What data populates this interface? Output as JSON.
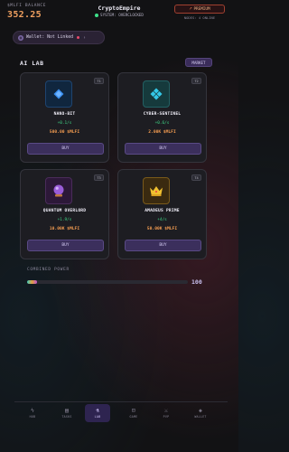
{
  "header": {
    "balance_label": "$MLFI BALANCE",
    "balance_value": "352.25",
    "app_title": "CryptoEmpire",
    "system_status": "SYSTEM: OVERCLOCKED",
    "premium_label": "PREMIUM",
    "server_info": "NODES: 4 ONLINE"
  },
  "wallet": {
    "label": "Wallet: Not Linked"
  },
  "section": {
    "title": "AI LAB",
    "market_label": "MARKET"
  },
  "items": [
    {
      "level": "T1",
      "name": "NANO-BIT",
      "rate": "+0.1/s",
      "cost": "500.00 $MLFI",
      "buy_label": "BUY",
      "icon": "diamond-icon",
      "icon_color": "#3a8ff0"
    },
    {
      "level": "T2",
      "name": "CYBER-SENTINEL",
      "rate": "+0.6/s",
      "cost": "2.00K $MLFI",
      "buy_label": "BUY",
      "icon": "quad-diamond-icon",
      "icon_color": "#34c8e8"
    },
    {
      "level": "T3",
      "name": "QUANTUM OVERLORD",
      "rate": "+1.9/s",
      "cost": "10.00K $MLFI",
      "buy_label": "BUY",
      "icon": "crystal-ball-icon",
      "icon_color": "#9a5cd8"
    },
    {
      "level": "T4",
      "name": "AMADEUS PRIME",
      "rate": "+4/s",
      "cost": "50.00K $MLFI",
      "buy_label": "BUY",
      "icon": "crown-icon",
      "icon_color": "#f0c030"
    }
  ],
  "power": {
    "label": "COMBINED POWER",
    "value": "100",
    "fill_fraction": 0.06
  },
  "nav": [
    {
      "label": "HUB",
      "icon": "lightning-icon",
      "active": false
    },
    {
      "label": "TASKS",
      "icon": "clipboard-icon",
      "active": false
    },
    {
      "label": "LAB",
      "icon": "test-tube-icon",
      "active": true
    },
    {
      "label": "GAME",
      "icon": "gamepad-icon",
      "active": false
    },
    {
      "label": "PVP",
      "icon": "swords-icon",
      "active": false
    },
    {
      "label": "WALLET",
      "icon": "gem-icon",
      "active": false
    }
  ]
}
